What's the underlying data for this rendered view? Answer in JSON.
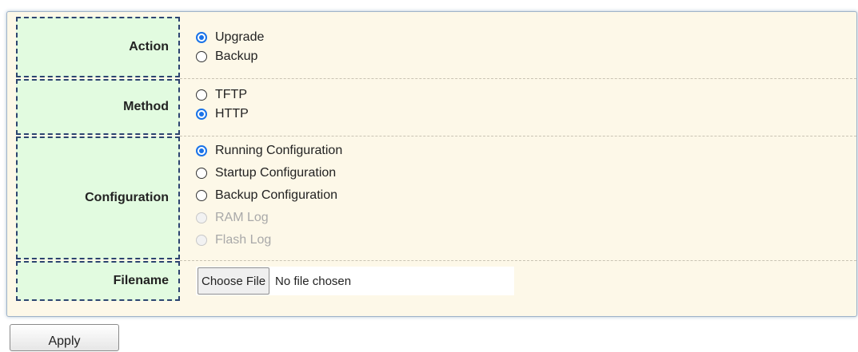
{
  "form": {
    "action": {
      "label": "Action",
      "options": [
        {
          "label": "Upgrade",
          "checked": true,
          "disabled": false
        },
        {
          "label": "Backup",
          "checked": false,
          "disabled": false
        }
      ]
    },
    "method": {
      "label": "Method",
      "options": [
        {
          "label": "TFTP",
          "checked": false,
          "disabled": false
        },
        {
          "label": "HTTP",
          "checked": true,
          "disabled": false
        }
      ]
    },
    "configuration": {
      "label": "Configuration",
      "options": [
        {
          "label": "Running Configuration",
          "checked": true,
          "disabled": false
        },
        {
          "label": "Startup Configuration",
          "checked": false,
          "disabled": false
        },
        {
          "label": "Backup Configuration",
          "checked": false,
          "disabled": false
        },
        {
          "label": "RAM Log",
          "checked": false,
          "disabled": true
        },
        {
          "label": "Flash Log",
          "checked": false,
          "disabled": true
        }
      ]
    },
    "filename": {
      "label": "Filename",
      "button_label": "Choose File",
      "status_text": "No file chosen"
    }
  },
  "apply_label": "Apply",
  "colors": {
    "label_bg": "#e2fbe0",
    "value_bg": "#fdf8e8",
    "label_border": "#2c4470",
    "radio_checked": "#1a73e8"
  }
}
